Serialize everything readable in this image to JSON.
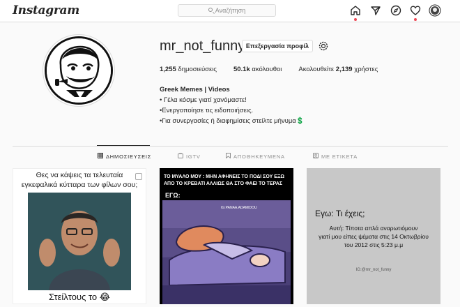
{
  "header": {
    "logo_text": "Instagram",
    "search_placeholder": "Αναζήτηση",
    "nav_icons": [
      "home-icon",
      "direct-icon",
      "explore-icon",
      "activity-heart-icon",
      "profile-avatar-icon"
    ]
  },
  "profile": {
    "username": "mr_not_funny",
    "edit_button": "Επεξεργασία προφίλ",
    "posts_count": "1,255",
    "posts_label": "δημοσιεύσεις",
    "followers_count": "50.1k",
    "followers_label": "ακόλουθοι",
    "following_prefix": "Ακολουθείτε",
    "following_count": "2,139",
    "following_label": "χρήστες",
    "bio_name": "Greek Memes | Videos",
    "bio_lines": [
      "• Γέλα κόσμε γιατί χανόμαστε!",
      "•Ενεργοποίησε τις ειδοποιήσεις.",
      "•Για συνεργασίες ή διαφημίσεις στείλτε μήνυμα💲"
    ]
  },
  "tabs": [
    {
      "label": "ΔΗΜΟΣΙΕΥΣΕΙΣ",
      "active": true
    },
    {
      "label": "IGTV",
      "active": false
    },
    {
      "label": "ΑΠΟΘΗΚΕΥΜΕΝΑ",
      "active": false
    },
    {
      "label": "ΜΕ ΕΤΙΚΕΤΑ",
      "active": false
    }
  ],
  "posts": [
    {
      "caption_line1": "Θες να κάψεις τα τελευταία",
      "caption_line2": "εγκεφαλικά κύτταρα των φίλων σου;",
      "bottom_text": "Στείλτους το 😂"
    },
    {
      "line1": "ΤΟ ΜΥΑΛΟ ΜΟΥ : ΜΗΝ ΑΦΗΝΕΙΣ ΤΟ ΠΟΔΙ ΣΟΥ ΕΞΩ ΑΠΟ ΤΟ ΚΡΕΒΑΤΙ ΑΛΛΙΩΣ ΘΑ ΣΤΟ ΦΑΕΙ ΤΟ ΤΕΡΑΣ",
      "line2": "ΕΓΩ:",
      "watermark": "IG:PANAA.ADAMIDOU"
    },
    {
      "title": "Εγω: Τι έχεις;",
      "line1": "Αυτή: Τίποτα απλά αναρωτιόμουν",
      "line2": "γιατί μου είπες ψέματα στις 14 Οκτωβρίου",
      "line3": "του 2012 στις 5:23 μ.μ",
      "handle": "IG:@mr_not_funny"
    }
  ]
}
